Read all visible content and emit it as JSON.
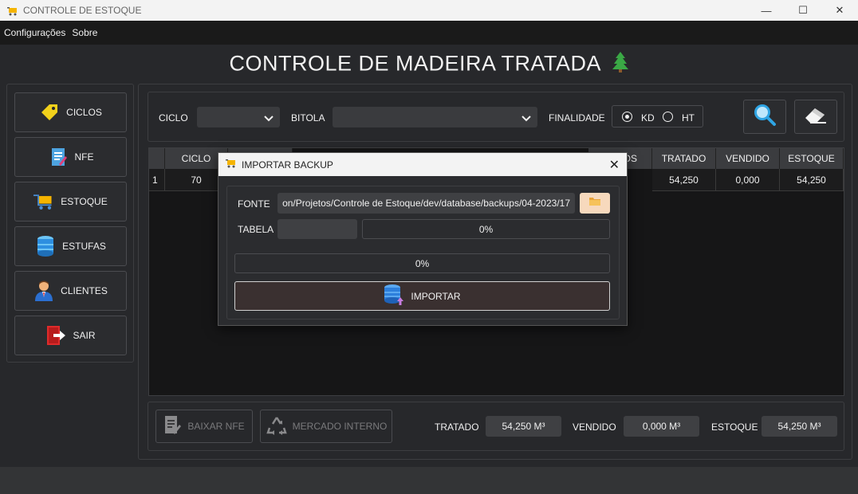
{
  "window": {
    "title": "CONTROLE DE ESTOQUE",
    "minimize": "—",
    "maximize": "☐",
    "close": "✕"
  },
  "menu": [
    "Configurações",
    "Sobre"
  ],
  "header": {
    "title": "CONTROLE DE MADEIRA TRATADA"
  },
  "sidebar": {
    "items": [
      {
        "label": "CICLOS",
        "icon": "tag-icon"
      },
      {
        "label": "NFE",
        "icon": "document-icon"
      },
      {
        "label": "ESTOQUE",
        "icon": "cart-icon"
      },
      {
        "label": "ESTUFAS",
        "icon": "barrel-icon"
      },
      {
        "label": "CLIENTES",
        "icon": "person-icon"
      },
      {
        "label": "SAIR",
        "icon": "exit-icon"
      }
    ]
  },
  "filters": {
    "ciclo_label": "CICLO",
    "bitola_label": "BITOLA",
    "finalidade_label": "FINALIDADE",
    "options": [
      {
        "label": "KD",
        "checked": true
      },
      {
        "label": "HT",
        "checked": false
      }
    ]
  },
  "table": {
    "columns": [
      "CICLO",
      "OS",
      "TRATADO",
      "VENDIDO",
      "ESTOQUE"
    ],
    "row_number": "1",
    "row": {
      "ciclo": "70",
      "tratado": "54,250",
      "vendido": "0,000",
      "estoque": "54,250"
    }
  },
  "footer": {
    "baixar_label": "BAIXAR NFE",
    "mercado_label": "MERCADO INTERNO",
    "tratado_label": "TRATADO",
    "tratado_value": "54,250 M³",
    "vendido_label": "VENDIDO",
    "vendido_value": "0,000 M³",
    "estoque_label": "ESTOQUE",
    "estoque_value": "54,250 M³"
  },
  "dialog": {
    "title": "IMPORTAR BACKUP",
    "fonte_label": "FONTE",
    "fonte_value": "on/Projetos/Controle de Estoque/dev/database/backups/04-2023/17",
    "tabela_label": "TABELA",
    "tabela_progress": "0%",
    "total_progress": "0%",
    "import_label": "IMPORTAR"
  },
  "colors": {
    "accent_folder": "#f7d9bd",
    "background": "#27282b"
  }
}
